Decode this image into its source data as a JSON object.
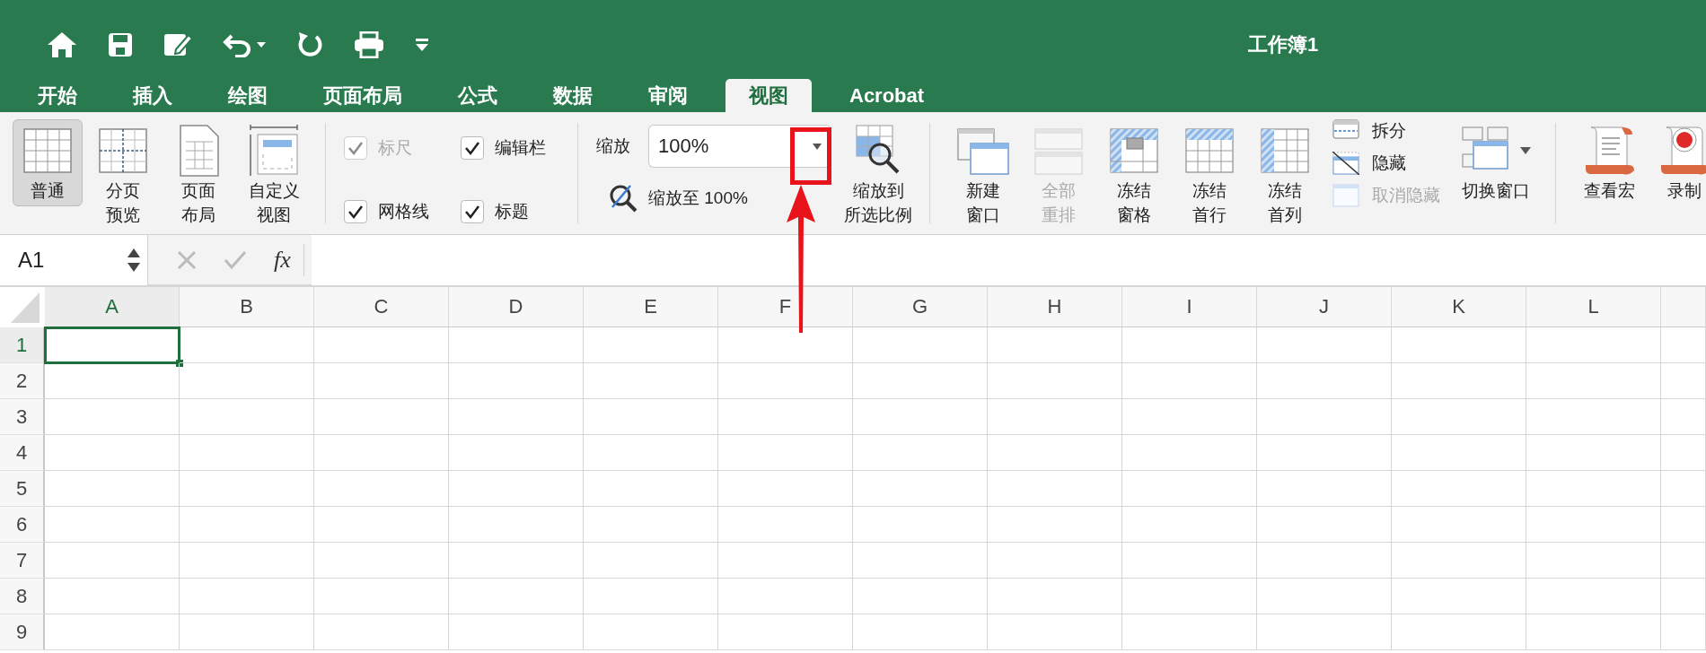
{
  "window": {
    "title": "工作簿1"
  },
  "tabs": [
    {
      "label": "开始",
      "selected": false
    },
    {
      "label": "插入",
      "selected": false
    },
    {
      "label": "绘图",
      "selected": false
    },
    {
      "label": "页面布局",
      "selected": false
    },
    {
      "label": "公式",
      "selected": false
    },
    {
      "label": "数据",
      "selected": false
    },
    {
      "label": "审阅",
      "selected": false
    },
    {
      "label": "视图",
      "selected": true
    },
    {
      "label": "Acrobat",
      "selected": false
    }
  ],
  "ribbon": {
    "view_buttons": [
      {
        "label_lines": [
          "普通"
        ],
        "selected": true
      },
      {
        "label_lines": [
          "分页",
          "预览"
        ],
        "selected": false
      },
      {
        "label_lines": [
          "页面",
          "布局"
        ],
        "selected": false
      },
      {
        "label_lines": [
          "自定义",
          "视图"
        ],
        "selected": false
      }
    ],
    "show_options": [
      {
        "label": "标尺",
        "checked": true,
        "disabled": true
      },
      {
        "label": "编辑栏",
        "checked": true,
        "disabled": false
      },
      {
        "label": "网格线",
        "checked": true,
        "disabled": false
      },
      {
        "label": "标题",
        "checked": true,
        "disabled": false
      }
    ],
    "zoom": {
      "label": "缩放",
      "value": "100%",
      "zoom_100_button": "缩放至 100%",
      "zoom_selection_button": [
        "缩放到",
        "所选比例"
      ]
    },
    "window_buttons": [
      {
        "label_lines": [
          "新建",
          "窗口"
        ],
        "disabled": false
      },
      {
        "label_lines": [
          "全部",
          "重排"
        ],
        "disabled": true
      },
      {
        "label_lines": [
          "冻结",
          "窗格"
        ],
        "disabled": false
      },
      {
        "label_lines": [
          "冻结",
          "首行"
        ],
        "disabled": false
      },
      {
        "label_lines": [
          "冻结",
          "首列"
        ],
        "disabled": false
      }
    ],
    "window_options": [
      {
        "label": "拆分",
        "disabled": false
      },
      {
        "label": "隐藏",
        "disabled": false
      },
      {
        "label": "取消隐藏",
        "disabled": true
      }
    ],
    "switch_windows": "切换窗口",
    "macro_buttons": [
      {
        "label": "查看宏"
      },
      {
        "label": "录制"
      }
    ]
  },
  "formula_bar": {
    "name_box": "A1",
    "function_label": "fx"
  },
  "sheet": {
    "columns": [
      {
        "label": "A",
        "selected": true
      },
      {
        "label": "B",
        "selected": false
      },
      {
        "label": "C",
        "selected": false
      },
      {
        "label": "D",
        "selected": false
      },
      {
        "label": "E",
        "selected": false
      },
      {
        "label": "F",
        "selected": false
      },
      {
        "label": "G",
        "selected": false
      },
      {
        "label": "H",
        "selected": false
      },
      {
        "label": "I",
        "selected": false
      },
      {
        "label": "J",
        "selected": false
      },
      {
        "label": "K",
        "selected": false
      },
      {
        "label": "L",
        "selected": false
      }
    ],
    "rows": [
      {
        "label": "1",
        "selected": true
      },
      {
        "label": "2",
        "selected": false
      },
      {
        "label": "3",
        "selected": false
      },
      {
        "label": "4",
        "selected": false
      },
      {
        "label": "5",
        "selected": false
      },
      {
        "label": "6",
        "selected": false
      },
      {
        "label": "7",
        "selected": false
      },
      {
        "label": "8",
        "selected": false
      },
      {
        "label": "9",
        "selected": false
      }
    ]
  }
}
